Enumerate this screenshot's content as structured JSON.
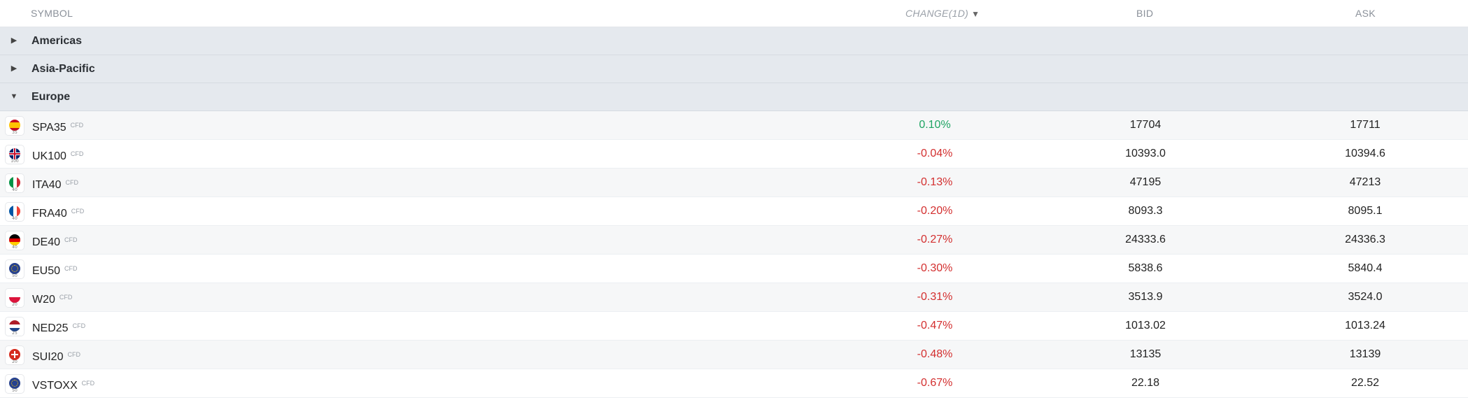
{
  "header": {
    "symbol": "SYMBOL",
    "change": "CHANGE(1D)",
    "sort_indicator": "▼",
    "bid": "BID",
    "ask": "ASK"
  },
  "groups": [
    {
      "label": "Americas",
      "expanded": false
    },
    {
      "label": "Asia-Pacific",
      "expanded": false
    },
    {
      "label": "Europe",
      "expanded": true
    }
  ],
  "caret_collapsed": "▶",
  "caret_expanded": "▼",
  "rows": [
    {
      "symbol": "SPA35",
      "tag": "CFD",
      "flag_code": "35",
      "flag_icon": "spain-flag-icon",
      "change": "0.10%",
      "direction": "up",
      "bid": "17704",
      "ask": "17711"
    },
    {
      "symbol": "UK100",
      "tag": "CFD",
      "flag_code": "100",
      "flag_icon": "uk-flag-icon",
      "change": "-0.04%",
      "direction": "down",
      "bid": "10393.0",
      "ask": "10394.6"
    },
    {
      "symbol": "ITA40",
      "tag": "CFD",
      "flag_code": "40",
      "flag_icon": "italy-flag-icon",
      "change": "-0.13%",
      "direction": "down",
      "bid": "47195",
      "ask": "47213"
    },
    {
      "symbol": "FRA40",
      "tag": "CFD",
      "flag_code": "40",
      "flag_icon": "france-flag-icon",
      "change": "-0.20%",
      "direction": "down",
      "bid": "8093.3",
      "ask": "8095.1"
    },
    {
      "symbol": "DE40",
      "tag": "CFD",
      "flag_code": "40",
      "flag_icon": "germany-flag-icon",
      "change": "-0.27%",
      "direction": "down",
      "bid": "24333.6",
      "ask": "24336.3"
    },
    {
      "symbol": "EU50",
      "tag": "CFD",
      "flag_code": "50",
      "flag_icon": "eu-flag-icon",
      "change": "-0.30%",
      "direction": "down",
      "bid": "5838.6",
      "ask": "5840.4"
    },
    {
      "symbol": "W20",
      "tag": "CFD",
      "flag_code": "20",
      "flag_icon": "poland-flag-icon",
      "change": "-0.31%",
      "direction": "down",
      "bid": "3513.9",
      "ask": "3524.0"
    },
    {
      "symbol": "NED25",
      "tag": "CFD",
      "flag_code": "25",
      "flag_icon": "netherlands-flag-icon",
      "change": "-0.47%",
      "direction": "down",
      "bid": "1013.02",
      "ask": "1013.24"
    },
    {
      "symbol": "SUI20",
      "tag": "CFD",
      "flag_code": "20",
      "flag_icon": "switzerland-flag-icon",
      "change": "-0.48%",
      "direction": "down",
      "bid": "13135",
      "ask": "13139"
    },
    {
      "symbol": "VSTOXX",
      "tag": "CFD",
      "flag_code": "50",
      "flag_icon": "eu-flag-icon",
      "change": "-0.67%",
      "direction": "down",
      "bid": "22.18",
      "ask": "22.52"
    }
  ],
  "colors": {
    "positive": "#1fa463",
    "negative": "#d32f2f",
    "group_bg": "#e5e9ee"
  }
}
